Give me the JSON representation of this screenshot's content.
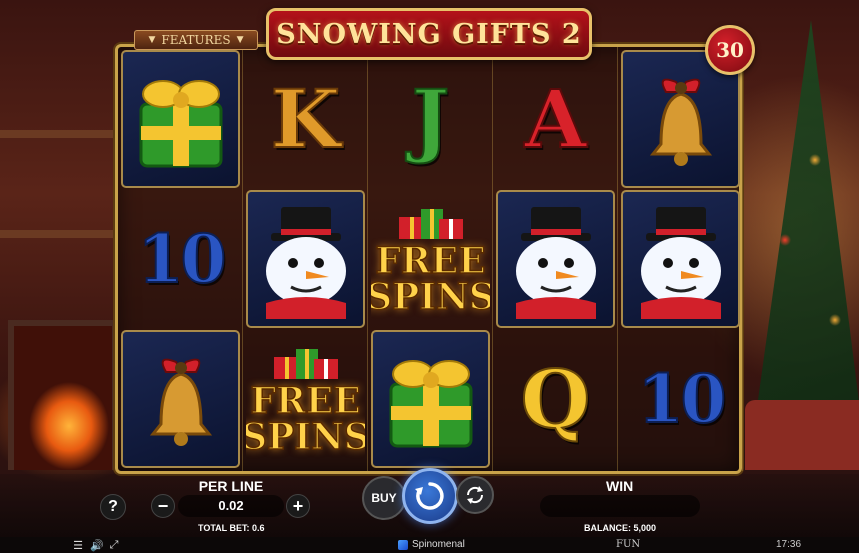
{
  "game": {
    "title": "SNOWING GIFTS 2",
    "features_label": "FEATURES",
    "lines": "30"
  },
  "reels": [
    [
      {
        "symbol": "gift-green",
        "framed": true
      },
      {
        "symbol": "10",
        "framed": false
      },
      {
        "symbol": "bell",
        "framed": true
      }
    ],
    [
      {
        "symbol": "K",
        "framed": false
      },
      {
        "symbol": "snowman",
        "framed": true
      },
      {
        "symbol": "free-spins",
        "framed": false
      }
    ],
    [
      {
        "symbol": "J",
        "framed": false
      },
      {
        "symbol": "free-spins",
        "framed": false
      },
      {
        "symbol": "gift-green",
        "framed": true
      }
    ],
    [
      {
        "symbol": "A",
        "framed": false
      },
      {
        "symbol": "snowman",
        "framed": true
      },
      {
        "symbol": "Q",
        "framed": false
      }
    ],
    [
      {
        "symbol": "bell",
        "framed": true
      },
      {
        "symbol": "snowman",
        "framed": true
      },
      {
        "symbol": "10",
        "framed": false
      }
    ]
  ],
  "free_spins_text": [
    "FREE",
    "SPINS"
  ],
  "controls": {
    "help_label": "?",
    "minus_label": "−",
    "plus_label": "+",
    "per_line_label": "PER LINE",
    "per_line_value": "0.02",
    "total_bet_text": "TOTAL BET: 0.6",
    "buy_label": "BUY",
    "win_label": "WIN",
    "balance_text": "BALANCE: 5,000"
  },
  "status": {
    "brand": "Spinomenal",
    "mode": "FUN",
    "time": "17:36"
  },
  "colors": {
    "title_bg": "#b4121a",
    "gold": "#e8c16a",
    "spin_blue": "#3a78d8"
  }
}
